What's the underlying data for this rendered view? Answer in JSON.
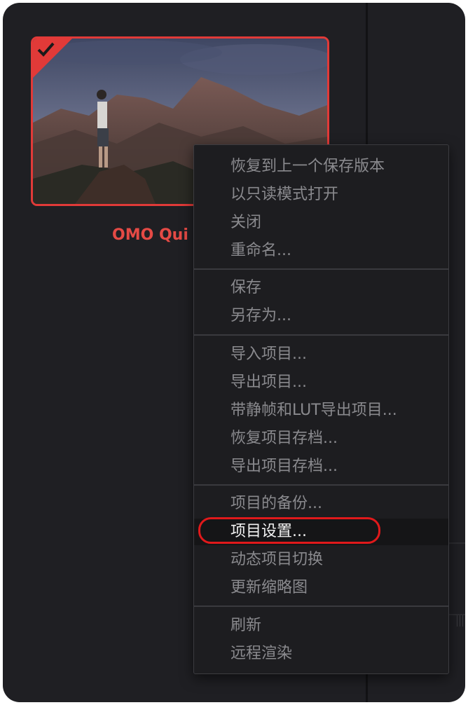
{
  "project": {
    "name": "OMO Qui",
    "selected": true,
    "icons": {
      "selected_check": "checkmark-icon"
    }
  },
  "context_menu": {
    "groups": [
      [
        "恢复到上一个保存版本",
        "以只读模式打开",
        "关闭",
        "重命名..."
      ],
      [
        "保存",
        "另存为..."
      ],
      [
        "导入项目...",
        "导出项目...",
        "带静帧和LUT导出项目...",
        "恢复项目存档...",
        "导出项目存档..."
      ],
      [
        "项目的备份...",
        "项目设置...",
        "动态项目切换",
        "更新缩略图"
      ],
      [
        "刷新",
        "远程渲染"
      ]
    ],
    "highlighted_item": "项目设置..."
  },
  "colors": {
    "panel_bg": "#1f1f23",
    "accent_red": "#e13a38",
    "menu_bg": "#1d1d20",
    "menu_text": "#8a8a8e",
    "active_text": "#f2f2f2",
    "annotation_ring": "#e0191b"
  }
}
